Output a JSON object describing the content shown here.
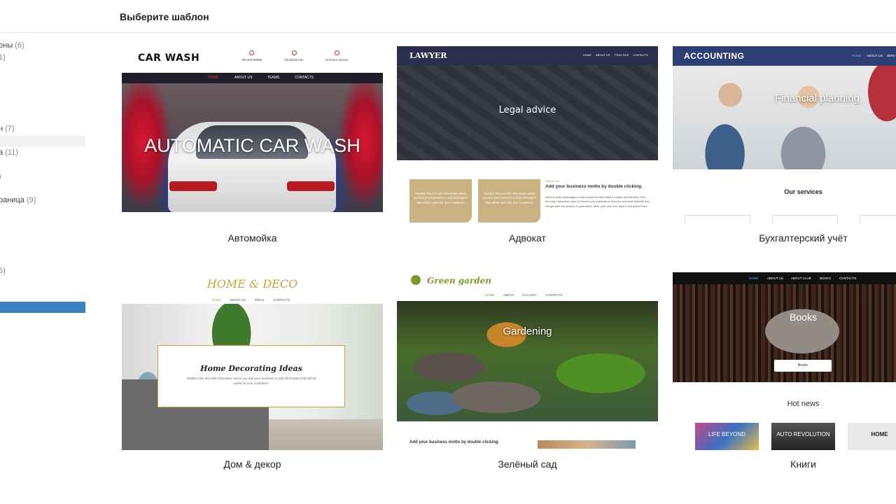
{
  "header": {
    "title": "Выберите шаблон"
  },
  "sidebar": {
    "items": [
      {
        "label": "оны",
        "count": "(6)"
      },
      {
        "label": "",
        "count": "1)"
      },
      {
        "label": "н",
        "count": "(7)"
      },
      {
        "label": "а",
        "count": "(11)"
      },
      {
        "label": "",
        "count": ")"
      },
      {
        "label": "раница",
        "count": "(9)"
      },
      {
        "label": "",
        "count": "5)"
      }
    ]
  },
  "templates": [
    {
      "name": "Автомойка",
      "preview": {
        "logo": "CAR WASH",
        "contacts": [
          "+00 000 00000",
          "info@site.info",
          "24 hours service"
        ],
        "nav": [
          "HOME",
          "ABOUT US",
          "TEAMS",
          "CONTACTS"
        ],
        "hero": "AUTOMATIC CAR WASH"
      }
    },
    {
      "name": "Адвокат",
      "preview": {
        "logo": "LAWYER",
        "nav": [
          "HOME",
          "ABOUT US",
          "PRACTICE",
          "CONTACTS"
        ],
        "hero": "Legal advice",
        "box_text": "Replace this text with information about you and your business or add information that will be useful for your customers",
        "why": "Why us me",
        "motto": "Add your business motto by double clicking.",
        "para": "Add the main advantages of your business that make it unique and the best. Add text why customers have to choose your products or services and what benefits they will get after the product is purchased. Write your own text, style it and press Done."
      }
    },
    {
      "name": "Бухгалтерский учёт",
      "preview": {
        "logo": "ACCOUNTING",
        "nav": [
          "HOME",
          "ABOUT US",
          "SERV"
        ],
        "hero": "Financial planning",
        "services": "Our services"
      }
    },
    {
      "name": "Дом & декор",
      "preview": {
        "logo": "HOME & DECO",
        "nav": [
          "HOME",
          "ABOUT US",
          "IDEAS",
          "CONTACTS"
        ],
        "box_title": "Home Decorating Ideas",
        "box_text": "Replace this text with information about you and your business or add information that will be useful for your customers."
      }
    },
    {
      "name": "Зелёный сад",
      "preview": {
        "logo": "Green garden",
        "nav": [
          "HOME",
          "ABOUT",
          "GALLERY",
          "CONTACTS"
        ],
        "hero": "Gardening",
        "motto": "Add your business motto by double clicking."
      }
    },
    {
      "name": "Книги",
      "preview": {
        "nav": [
          "HOME",
          "ABOUT US",
          "ABOUT CLUB",
          "BOOKS",
          "CONTACTS"
        ],
        "hero": "Books",
        "button": "Books",
        "news": "Hot news",
        "covers": [
          "LIFE BEYOND",
          "AUTO REVOLUTION",
          "HOME"
        ]
      }
    }
  ],
  "colors": {
    "accent_blue": "#3a82c4",
    "carwash_red": "#d8262f",
    "lawyer_navy": "#2a2f4d",
    "accounting_navy": "#2f3e73",
    "deco_gold": "#c7a436",
    "garden_green": "#7a9a2a"
  }
}
